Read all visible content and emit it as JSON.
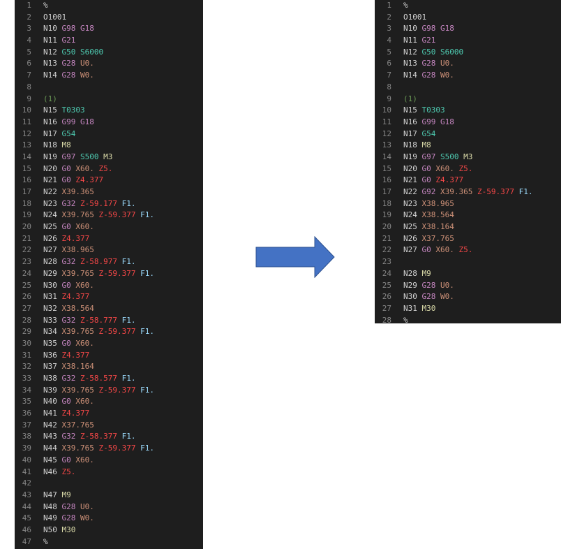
{
  "colors": {
    "background": "#1e1e1e",
    "line_number": "#858585",
    "n": "#d4d4d4",
    "pink": "#c586c0",
    "teal": "#4ec9b0",
    "yellow": "#dcdcaa",
    "orange": "#ce9178",
    "red": "#f44747",
    "blue": "#9cdcfe",
    "green": "#6a9955",
    "arrow_fill": "#4472c4",
    "arrow_stroke": "#2f528f"
  },
  "icon": "right-arrow-icon",
  "left_editor": {
    "lines": [
      [
        [
          "plain",
          "%"
        ]
      ],
      [
        [
          "plain",
          "O1001"
        ]
      ],
      [
        [
          "n",
          "N10 "
        ],
        [
          "pink",
          "G98"
        ],
        [
          "plain",
          " "
        ],
        [
          "pink",
          "G18"
        ]
      ],
      [
        [
          "n",
          "N11 "
        ],
        [
          "pink",
          "G21"
        ]
      ],
      [
        [
          "n",
          "N12 "
        ],
        [
          "teal",
          "G50"
        ],
        [
          "plain",
          " "
        ],
        [
          "teal",
          "S6000"
        ]
      ],
      [
        [
          "n",
          "N13 "
        ],
        [
          "pink",
          "G28"
        ],
        [
          "plain",
          " "
        ],
        [
          "orange",
          "U0."
        ]
      ],
      [
        [
          "n",
          "N14 "
        ],
        [
          "pink",
          "G28"
        ],
        [
          "plain",
          " "
        ],
        [
          "orange",
          "W0."
        ]
      ],
      [],
      [
        [
          "green",
          "(1)"
        ]
      ],
      [
        [
          "n",
          "N15 "
        ],
        [
          "teal",
          "T0303"
        ]
      ],
      [
        [
          "n",
          "N16 "
        ],
        [
          "pink",
          "G99"
        ],
        [
          "plain",
          " "
        ],
        [
          "pink",
          "G18"
        ]
      ],
      [
        [
          "n",
          "N17 "
        ],
        [
          "teal",
          "G54"
        ]
      ],
      [
        [
          "n",
          "N18 "
        ],
        [
          "yellow",
          "M8"
        ]
      ],
      [
        [
          "n",
          "N19 "
        ],
        [
          "pink",
          "G97"
        ],
        [
          "plain",
          " "
        ],
        [
          "teal",
          "S500"
        ],
        [
          "plain",
          " "
        ],
        [
          "yellow",
          "M3"
        ]
      ],
      [
        [
          "n",
          "N20 "
        ],
        [
          "pink",
          "G0"
        ],
        [
          "plain",
          " "
        ],
        [
          "orange",
          "X60."
        ],
        [
          "plain",
          " "
        ],
        [
          "red",
          "Z5."
        ]
      ],
      [
        [
          "n",
          "N21 "
        ],
        [
          "pink",
          "G0"
        ],
        [
          "plain",
          " "
        ],
        [
          "red",
          "Z4.377"
        ]
      ],
      [
        [
          "n",
          "N22 "
        ],
        [
          "orange",
          "X39.365"
        ]
      ],
      [
        [
          "n",
          "N23 "
        ],
        [
          "pink",
          "G32"
        ],
        [
          "plain",
          " "
        ],
        [
          "red",
          "Z-59.177"
        ],
        [
          "plain",
          " "
        ],
        [
          "blue",
          "F1."
        ]
      ],
      [
        [
          "n",
          "N24 "
        ],
        [
          "orange",
          "X39.765"
        ],
        [
          "plain",
          " "
        ],
        [
          "red",
          "Z-59.377"
        ],
        [
          "plain",
          " "
        ],
        [
          "blue",
          "F1."
        ]
      ],
      [
        [
          "n",
          "N25 "
        ],
        [
          "pink",
          "G0"
        ],
        [
          "plain",
          " "
        ],
        [
          "orange",
          "X60."
        ]
      ],
      [
        [
          "n",
          "N26 "
        ],
        [
          "red",
          "Z4.377"
        ]
      ],
      [
        [
          "n",
          "N27 "
        ],
        [
          "orange",
          "X38.965"
        ]
      ],
      [
        [
          "n",
          "N28 "
        ],
        [
          "pink",
          "G32"
        ],
        [
          "plain",
          " "
        ],
        [
          "red",
          "Z-58.977"
        ],
        [
          "plain",
          " "
        ],
        [
          "blue",
          "F1."
        ]
      ],
      [
        [
          "n",
          "N29 "
        ],
        [
          "orange",
          "X39.765"
        ],
        [
          "plain",
          " "
        ],
        [
          "red",
          "Z-59.377"
        ],
        [
          "plain",
          " "
        ],
        [
          "blue",
          "F1."
        ]
      ],
      [
        [
          "n",
          "N30 "
        ],
        [
          "pink",
          "G0"
        ],
        [
          "plain",
          " "
        ],
        [
          "orange",
          "X60."
        ]
      ],
      [
        [
          "n",
          "N31 "
        ],
        [
          "red",
          "Z4.377"
        ]
      ],
      [
        [
          "n",
          "N32 "
        ],
        [
          "orange",
          "X38.564"
        ]
      ],
      [
        [
          "n",
          "N33 "
        ],
        [
          "pink",
          "G32"
        ],
        [
          "plain",
          " "
        ],
        [
          "red",
          "Z-58.777"
        ],
        [
          "plain",
          " "
        ],
        [
          "blue",
          "F1."
        ]
      ],
      [
        [
          "n",
          "N34 "
        ],
        [
          "orange",
          "X39.765"
        ],
        [
          "plain",
          " "
        ],
        [
          "red",
          "Z-59.377"
        ],
        [
          "plain",
          " "
        ],
        [
          "blue",
          "F1."
        ]
      ],
      [
        [
          "n",
          "N35 "
        ],
        [
          "pink",
          "G0"
        ],
        [
          "plain",
          " "
        ],
        [
          "orange",
          "X60."
        ]
      ],
      [
        [
          "n",
          "N36 "
        ],
        [
          "red",
          "Z4.377"
        ]
      ],
      [
        [
          "n",
          "N37 "
        ],
        [
          "orange",
          "X38.164"
        ]
      ],
      [
        [
          "n",
          "N38 "
        ],
        [
          "pink",
          "G32"
        ],
        [
          "plain",
          " "
        ],
        [
          "red",
          "Z-58.577"
        ],
        [
          "plain",
          " "
        ],
        [
          "blue",
          "F1."
        ]
      ],
      [
        [
          "n",
          "N39 "
        ],
        [
          "orange",
          "X39.765"
        ],
        [
          "plain",
          " "
        ],
        [
          "red",
          "Z-59.377"
        ],
        [
          "plain",
          " "
        ],
        [
          "blue",
          "F1."
        ]
      ],
      [
        [
          "n",
          "N40 "
        ],
        [
          "pink",
          "G0"
        ],
        [
          "plain",
          " "
        ],
        [
          "orange",
          "X60."
        ]
      ],
      [
        [
          "n",
          "N41 "
        ],
        [
          "red",
          "Z4.377"
        ]
      ],
      [
        [
          "n",
          "N42 "
        ],
        [
          "orange",
          "X37.765"
        ]
      ],
      [
        [
          "n",
          "N43 "
        ],
        [
          "pink",
          "G32"
        ],
        [
          "plain",
          " "
        ],
        [
          "red",
          "Z-58.377"
        ],
        [
          "plain",
          " "
        ],
        [
          "blue",
          "F1."
        ]
      ],
      [
        [
          "n",
          "N44 "
        ],
        [
          "orange",
          "X39.765"
        ],
        [
          "plain",
          " "
        ],
        [
          "red",
          "Z-59.377"
        ],
        [
          "plain",
          " "
        ],
        [
          "blue",
          "F1."
        ]
      ],
      [
        [
          "n",
          "N45 "
        ],
        [
          "pink",
          "G0"
        ],
        [
          "plain",
          " "
        ],
        [
          "orange",
          "X60."
        ]
      ],
      [
        [
          "n",
          "N46 "
        ],
        [
          "red",
          "Z5."
        ]
      ],
      [],
      [
        [
          "n",
          "N47 "
        ],
        [
          "yellow",
          "M9"
        ]
      ],
      [
        [
          "n",
          "N48 "
        ],
        [
          "pink",
          "G28"
        ],
        [
          "plain",
          " "
        ],
        [
          "orange",
          "U0."
        ]
      ],
      [
        [
          "n",
          "N49 "
        ],
        [
          "pink",
          "G28"
        ],
        [
          "plain",
          " "
        ],
        [
          "orange",
          "W0."
        ]
      ],
      [
        [
          "n",
          "N50 "
        ],
        [
          "yellow",
          "M30"
        ]
      ],
      [
        [
          "plain",
          "%"
        ]
      ]
    ]
  },
  "right_editor": {
    "lines": [
      [
        [
          "plain",
          "%"
        ]
      ],
      [
        [
          "plain",
          "O1001"
        ]
      ],
      [
        [
          "n",
          "N10 "
        ],
        [
          "pink",
          "G98"
        ],
        [
          "plain",
          " "
        ],
        [
          "pink",
          "G18"
        ]
      ],
      [
        [
          "n",
          "N11 "
        ],
        [
          "pink",
          "G21"
        ]
      ],
      [
        [
          "n",
          "N12 "
        ],
        [
          "teal",
          "G50"
        ],
        [
          "plain",
          " "
        ],
        [
          "teal",
          "S6000"
        ]
      ],
      [
        [
          "n",
          "N13 "
        ],
        [
          "pink",
          "G28"
        ],
        [
          "plain",
          " "
        ],
        [
          "orange",
          "U0."
        ]
      ],
      [
        [
          "n",
          "N14 "
        ],
        [
          "pink",
          "G28"
        ],
        [
          "plain",
          " "
        ],
        [
          "orange",
          "W0."
        ]
      ],
      [],
      [
        [
          "green",
          "(1)"
        ]
      ],
      [
        [
          "n",
          "N15 "
        ],
        [
          "teal",
          "T0303"
        ]
      ],
      [
        [
          "n",
          "N16 "
        ],
        [
          "pink",
          "G99"
        ],
        [
          "plain",
          " "
        ],
        [
          "pink",
          "G18"
        ]
      ],
      [
        [
          "n",
          "N17 "
        ],
        [
          "teal",
          "G54"
        ]
      ],
      [
        [
          "n",
          "N18 "
        ],
        [
          "yellow",
          "M8"
        ]
      ],
      [
        [
          "n",
          "N19 "
        ],
        [
          "pink",
          "G97"
        ],
        [
          "plain",
          " "
        ],
        [
          "teal",
          "S500"
        ],
        [
          "plain",
          " "
        ],
        [
          "yellow",
          "M3"
        ]
      ],
      [
        [
          "n",
          "N20 "
        ],
        [
          "pink",
          "G0"
        ],
        [
          "plain",
          " "
        ],
        [
          "orange",
          "X60."
        ],
        [
          "plain",
          " "
        ],
        [
          "red",
          "Z5."
        ]
      ],
      [
        [
          "n",
          "N21 "
        ],
        [
          "pink",
          "G0"
        ],
        [
          "plain",
          " "
        ],
        [
          "red",
          "Z4.377"
        ]
      ],
      [
        [
          "n",
          "N22 "
        ],
        [
          "pink",
          "G92"
        ],
        [
          "plain",
          " "
        ],
        [
          "orange",
          "X39.365"
        ],
        [
          "plain",
          " "
        ],
        [
          "red",
          "Z-59.377"
        ],
        [
          "plain",
          " "
        ],
        [
          "blue",
          "F1."
        ]
      ],
      [
        [
          "n",
          "N23 "
        ],
        [
          "orange",
          "X38.965"
        ]
      ],
      [
        [
          "n",
          "N24 "
        ],
        [
          "orange",
          "X38.564"
        ]
      ],
      [
        [
          "n",
          "N25 "
        ],
        [
          "orange",
          "X38.164"
        ]
      ],
      [
        [
          "n",
          "N26 "
        ],
        [
          "orange",
          "X37.765"
        ]
      ],
      [
        [
          "n",
          "N27 "
        ],
        [
          "pink",
          "G0"
        ],
        [
          "plain",
          " "
        ],
        [
          "orange",
          "X60."
        ],
        [
          "plain",
          " "
        ],
        [
          "red",
          "Z5."
        ]
      ],
      [],
      [
        [
          "n",
          "N28 "
        ],
        [
          "yellow",
          "M9"
        ]
      ],
      [
        [
          "n",
          "N29 "
        ],
        [
          "pink",
          "G28"
        ],
        [
          "plain",
          " "
        ],
        [
          "orange",
          "U0."
        ]
      ],
      [
        [
          "n",
          "N30 "
        ],
        [
          "pink",
          "G28"
        ],
        [
          "plain",
          " "
        ],
        [
          "orange",
          "W0."
        ]
      ],
      [
        [
          "n",
          "N31 "
        ],
        [
          "yellow",
          "M30"
        ]
      ],
      [
        [
          "plain",
          "%"
        ]
      ]
    ]
  }
}
